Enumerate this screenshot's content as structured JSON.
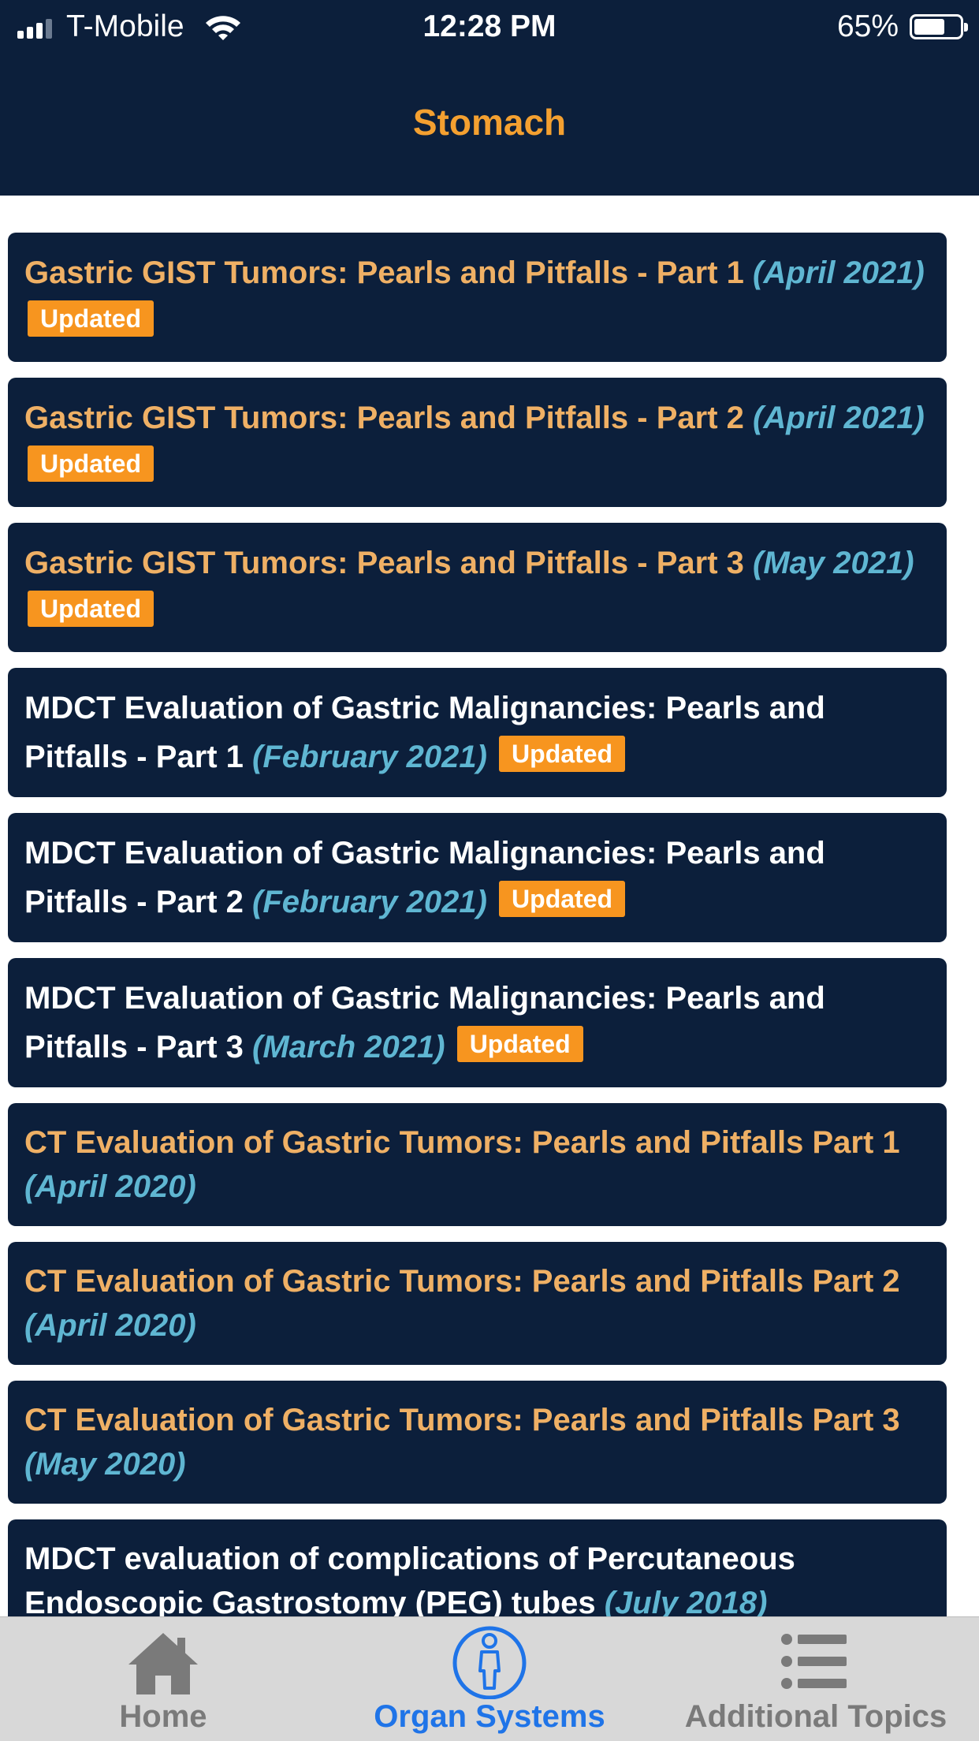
{
  "status_bar": {
    "carrier": "T-Mobile",
    "time": "12:28 PM",
    "battery_percent": "65%",
    "battery_level": 0.65,
    "signal_bars": 3,
    "signal_bars_total": 4
  },
  "header": {
    "title": "Stomach"
  },
  "colors": {
    "header_bg": "#0c1f3b",
    "title_orange": "#f4a030",
    "item_orange": "#efb065",
    "date_blue": "#5fb6d2",
    "badge_orange": "#f7951f",
    "tab_active": "#1f74e8",
    "tab_inactive": "#7a7a7a"
  },
  "items": [
    {
      "title": "Gastric GIST Tumors: Pearls and Pitfalls - Part 1",
      "date": "(April 2021)",
      "badge": "Updated",
      "style": "orange"
    },
    {
      "title": "Gastric GIST Tumors: Pearls and Pitfalls - Part 2",
      "date": "(April 2021)",
      "badge": "Updated",
      "style": "orange"
    },
    {
      "title": "Gastric GIST Tumors: Pearls and Pitfalls - Part 3",
      "date": "(May 2021)",
      "badge": "Updated",
      "style": "orange"
    },
    {
      "title": "MDCT Evaluation of Gastric Malignancies: Pearls and Pitfalls - Part 1",
      "date": "(February 2021)",
      "badge": "Updated",
      "style": "white"
    },
    {
      "title": "MDCT Evaluation of Gastric Malignancies: Pearls and Pitfalls - Part 2",
      "date": "(February 2021)",
      "badge": "Updated",
      "style": "white"
    },
    {
      "title": "MDCT Evaluation of Gastric Malignancies: Pearls and Pitfalls - Part 3",
      "date": "(March 2021)",
      "badge": "Updated",
      "style": "white"
    },
    {
      "title": "CT Evaluation of Gastric Tumors: Pearls and Pitfalls Part 1",
      "date": "(April 2020)",
      "badge": "",
      "style": "orange"
    },
    {
      "title": "CT Evaluation of Gastric Tumors: Pearls and Pitfalls Part 2",
      "date": "(April 2020)",
      "badge": "",
      "style": "orange"
    },
    {
      "title": "CT Evaluation of Gastric Tumors: Pearls and Pitfalls Part 3",
      "date": "(May 2020)",
      "badge": "",
      "style": "orange"
    },
    {
      "title": "MDCT evaluation of complications of Percutaneous Endoscopic Gastrostomy (PEG) tubes",
      "date": "(July 2018)",
      "badge": "",
      "style": "white"
    }
  ],
  "tabbar": {
    "tabs": [
      {
        "label": "Home",
        "icon": "home-icon",
        "active": false
      },
      {
        "label": "Organ Systems",
        "icon": "person-icon",
        "active": true
      },
      {
        "label": "Additional Topics",
        "icon": "list-icon",
        "active": false
      }
    ]
  }
}
